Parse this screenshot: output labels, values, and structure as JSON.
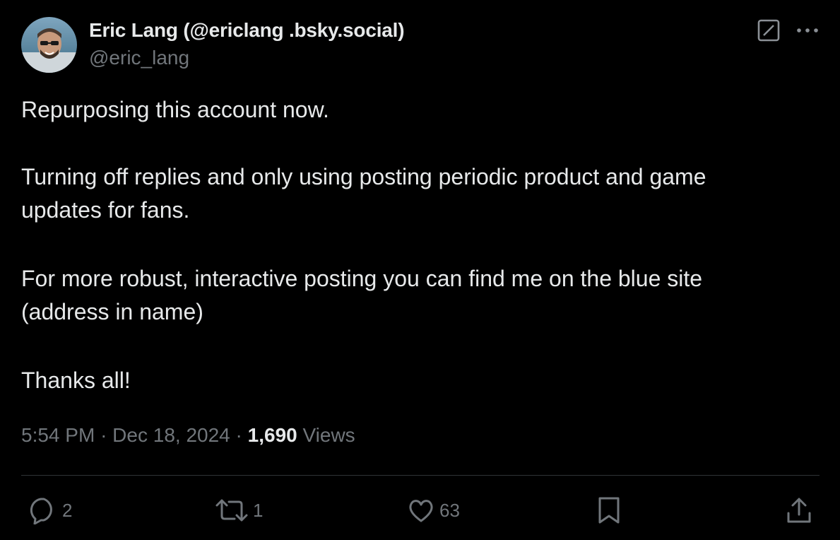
{
  "author": {
    "display_name": "Eric Lang (@ericlang .bsky.social)",
    "handle": "@eric_lang"
  },
  "header_icons": [
    "grok-icon",
    "more-icon"
  ],
  "post": {
    "paragraphs": [
      [
        "Repurposing this account now."
      ],
      [
        "Turning off replies and only using posting periodic product and game",
        "updates for fans."
      ],
      [
        "For more robust, interactive posting you can find me on the blue site",
        "(address in name)"
      ],
      [
        "Thanks all!"
      ]
    ],
    "time": "5:54 PM",
    "separator": "·",
    "date": "Dec 18, 2024",
    "views_count": "1,690",
    "views_label": "Views"
  },
  "actions": {
    "reply_count": "2",
    "repost_count": "1",
    "like_count": "63"
  },
  "colors": {
    "background": "#000000",
    "text": "#e7e9ea",
    "secondary": "#71767b",
    "divider": "#2f3336"
  }
}
